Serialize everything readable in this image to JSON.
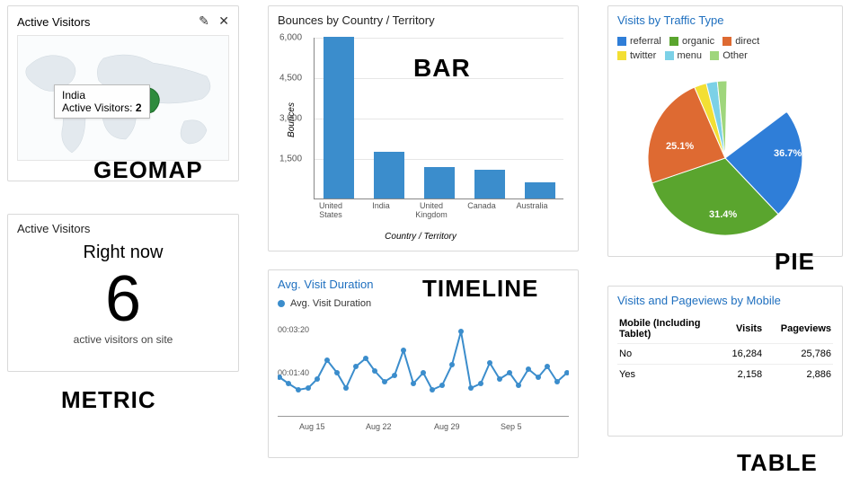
{
  "geomap": {
    "title": "Active Visitors",
    "tooltip_country": "India",
    "tooltip_label": "Active Visitors:",
    "tooltip_value": "2",
    "overlay": "GEOMAP"
  },
  "metric": {
    "title": "Active Visitors",
    "rightnow": "Right now",
    "value": "6",
    "sub": "active visitors on site",
    "overlay": "METRIC"
  },
  "bar": {
    "title": "Bounces by Country / Territory",
    "overlay": "BAR"
  },
  "timeline": {
    "title": "Avg. Visit Duration",
    "legend": "Avg. Visit Duration",
    "overlay": "TIMELINE",
    "ytick0": "00:03:20",
    "ytick1": "00:01:40",
    "x0": "Aug 15",
    "x1": "Aug 22",
    "x2": "Aug 29",
    "x3": "Sep 5"
  },
  "pie": {
    "title": "Visits by Traffic Type",
    "overlay": "PIE",
    "leg0": "referral",
    "leg1": "organic",
    "leg2": "direct",
    "leg3": "twitter",
    "leg4": "menu",
    "leg5": "Other",
    "lab0": "36.7%",
    "lab1": "31.4%",
    "lab2": "25.1%"
  },
  "table": {
    "title": "Visits and Pageviews by Mobile",
    "overlay": "TABLE",
    "col0": "Mobile (Including Tablet)",
    "col1": "Visits",
    "col2": "Pageviews",
    "r0c0": "No",
    "r0c1": "16,284",
    "r0c2": "25,786",
    "r1c0": "Yes",
    "r1c1": "2,158",
    "r1c2": "2,886"
  },
  "colors": {
    "referral": "#2f7ed8",
    "organic": "#5aa52e",
    "direct": "#de6a32",
    "twitter": "#f3df33",
    "menu": "#7cd1e7",
    "other": "#9fd67c",
    "bar": "#3b8dcc",
    "line": "#3b8dcc"
  },
  "chart_data": [
    {
      "type": "bar",
      "title": "Bounces by Country / Territory",
      "xlabel": "Country / Territory",
      "ylabel": "Bounces",
      "categories": [
        "United States",
        "India",
        "United Kingdom",
        "Canada",
        "Australia"
      ],
      "values": [
        6100,
        1750,
        1200,
        1100,
        600
      ],
      "ylim": [
        0,
        6000
      ],
      "yticks": [
        1500,
        3000,
        4500,
        6000
      ]
    },
    {
      "type": "line",
      "title": "Avg. Visit Duration",
      "xlabel": "",
      "ylabel": "",
      "x": [
        "Aug 12",
        "Aug 13",
        "Aug 14",
        "Aug 15",
        "Aug 16",
        "Aug 17",
        "Aug 18",
        "Aug 19",
        "Aug 20",
        "Aug 21",
        "Aug 22",
        "Aug 23",
        "Aug 24",
        "Aug 25",
        "Aug 26",
        "Aug 27",
        "Aug 28",
        "Aug 29",
        "Aug 30",
        "Aug 31",
        "Sep 1",
        "Sep 2",
        "Sep 3",
        "Sep 4",
        "Sep 5",
        "Sep 6",
        "Sep 7",
        "Sep 8",
        "Sep 9",
        "Sep 10",
        "Sep 11"
      ],
      "series": [
        {
          "name": "Avg. Visit Duration",
          "values_seconds": [
            85,
            70,
            55,
            60,
            80,
            125,
            95,
            60,
            110,
            130,
            100,
            75,
            90,
            150,
            70,
            95,
            55,
            65,
            115,
            195,
            60,
            70,
            120,
            80,
            95,
            65,
            105,
            85,
            110,
            75,
            95
          ]
        }
      ],
      "yticks_labels": [
        "00:01:40",
        "00:03:20"
      ],
      "yticks_seconds": [
        100,
        200
      ]
    },
    {
      "type": "pie",
      "title": "Visits by Traffic Type",
      "categories": [
        "referral",
        "organic",
        "direct",
        "twitter",
        "menu",
        "Other"
      ],
      "values_pct": [
        36.7,
        31.4,
        25.1,
        2.5,
        2.3,
        2.0
      ]
    },
    {
      "type": "table",
      "title": "Visits and Pageviews by Mobile",
      "columns": [
        "Mobile (Including Tablet)",
        "Visits",
        "Pageviews"
      ],
      "rows": [
        [
          "No",
          16284,
          25786
        ],
        [
          "Yes",
          2158,
          2886
        ]
      ]
    }
  ]
}
